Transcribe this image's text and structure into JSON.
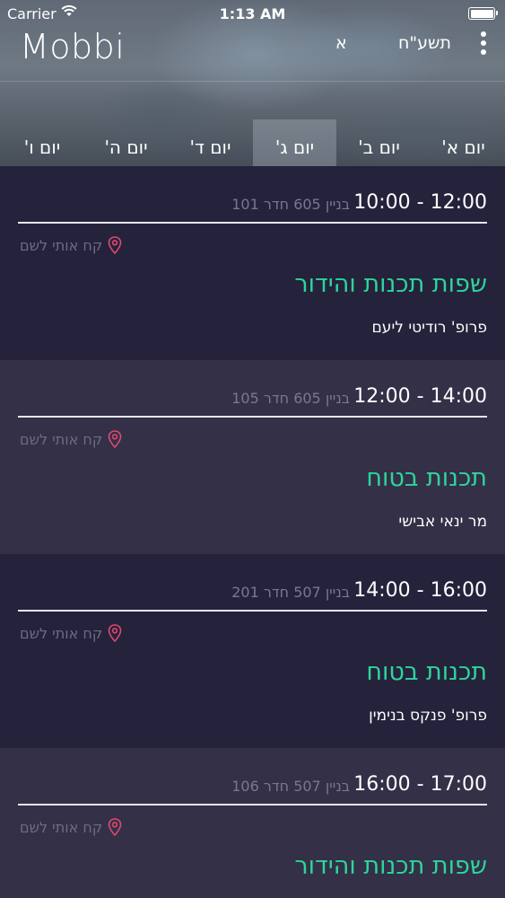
{
  "status_bar": {
    "carrier": "Carrier",
    "time": "1:13 AM"
  },
  "header": {
    "title": "Mobbi",
    "year": "תשע\"ח",
    "font_toggle": "א"
  },
  "tabs": [
    {
      "label": "יום א'"
    },
    {
      "label": "יום ב'"
    },
    {
      "label": "יום ג'"
    },
    {
      "label": "יום ד'"
    },
    {
      "label": "יום ה'"
    },
    {
      "label": "יום ו'"
    }
  ],
  "active_tab": "יום ג'",
  "lessons": [
    {
      "time": "10:00 - 12:00",
      "room": "בניין 605 חדר 101",
      "navigate": "קח אותי לשם",
      "course": "שפות תכנות והידור",
      "lecturer": "פרופ' רודיטי ליעם"
    },
    {
      "time": "12:00 - 14:00",
      "room": "בניין 605 חדר 105",
      "navigate": "קח אותי לשם",
      "course": "תכנות בטוח",
      "lecturer": "מר ינאי אבישי"
    },
    {
      "time": "14:00 - 16:00",
      "room": "בניין 507 חדר 201",
      "navigate": "קח אותי לשם",
      "course": "תכנות בטוח",
      "lecturer": "פרופ' פנקס בנימין"
    },
    {
      "time": "16:00 - 17:00",
      "room": "בניין 507 חדר 106",
      "navigate": "קח אותי לשם",
      "course": "שפות תכנות והידור",
      "lecturer": ""
    }
  ],
  "colors": {
    "accent_green": "#2ed59a",
    "pin_red": "#e0486d",
    "card_dark": "#25223c",
    "card_light": "#333048"
  },
  "icons": {
    "wifi": "wifi-icon",
    "battery": "battery-icon",
    "menu": "more-vertical-icon",
    "pin": "location-pin-icon"
  }
}
